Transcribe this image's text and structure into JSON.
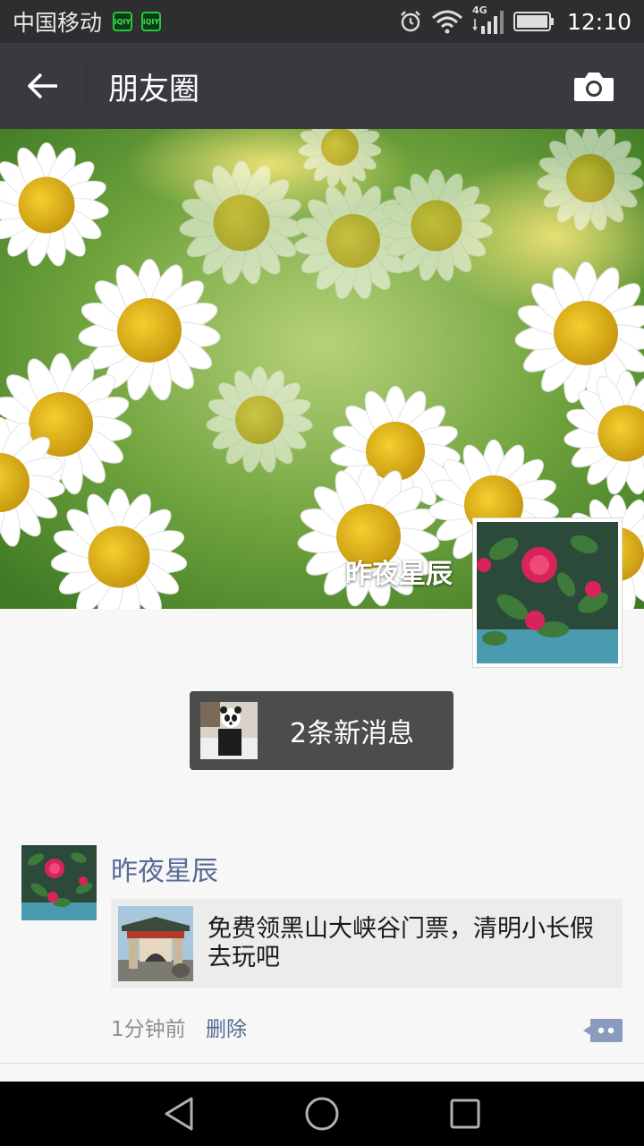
{
  "status_bar": {
    "carrier": "中国移动",
    "network_type": "4G",
    "time": "12:10",
    "app_badges": [
      "iQIYI",
      "iQIYI"
    ],
    "icons": [
      "alarm-icon",
      "wifi-icon",
      "signal-icon",
      "battery-icon"
    ]
  },
  "nav": {
    "title": "朋友圈",
    "back_icon": "back-arrow-icon",
    "camera_icon": "camera-icon"
  },
  "cover": {
    "username": "昨夜星辰"
  },
  "new_messages": {
    "label": "2条新消息"
  },
  "feed": {
    "posts": [
      {
        "user": "昨夜星辰",
        "link_title": "免费领黑山大峡谷门票，清明小长假去玩吧",
        "time": "1分钟前",
        "delete_label": "删除"
      }
    ]
  },
  "colors": {
    "status_bar_bg": "#2e2e30",
    "nav_bg": "#393a3f",
    "link_blue": "#576b95",
    "new_msg_bg": "#4c4c4c",
    "page_bg": "#f7f7f7"
  }
}
